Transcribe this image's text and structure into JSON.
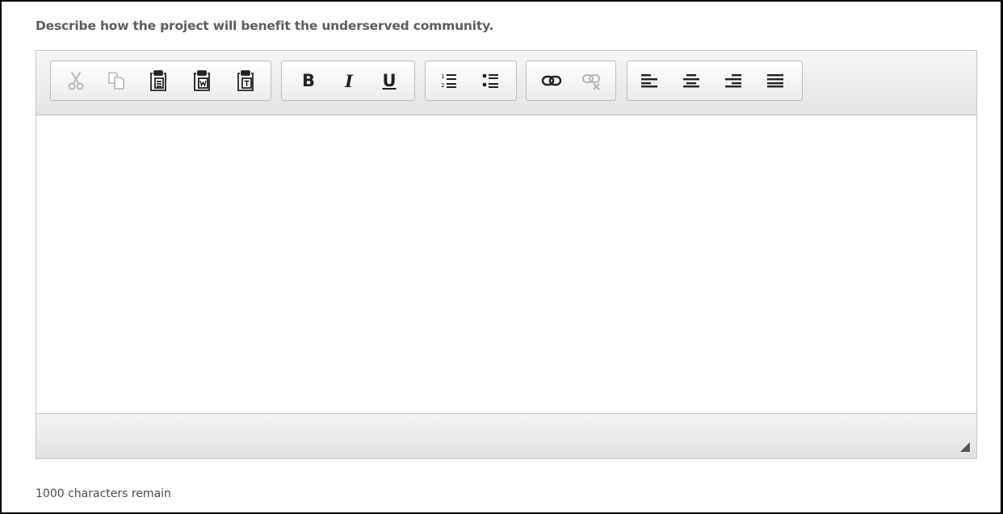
{
  "question": {
    "label": "Describe how the project will benefit the underserved community."
  },
  "editor": {
    "content": "",
    "toolbar": {
      "clipboard": [
        {
          "name": "cut-button",
          "icon": "scissors-icon",
          "enabled": false
        },
        {
          "name": "copy-button",
          "icon": "copy-icon",
          "enabled": false
        },
        {
          "name": "paste-button",
          "icon": "paste-icon",
          "enabled": true
        },
        {
          "name": "paste-from-word-button",
          "icon": "paste-word-icon",
          "enabled": true
        },
        {
          "name": "paste-as-text-button",
          "icon": "paste-text-icon",
          "enabled": true
        }
      ],
      "format": {
        "bold_label": "B",
        "italic_label": "I",
        "underline_label": "U"
      },
      "lists": [
        {
          "name": "numbered-list-button",
          "icon": "numbered-list-icon"
        },
        {
          "name": "bulleted-list-button",
          "icon": "bulleted-list-icon"
        }
      ],
      "links": [
        {
          "name": "link-button",
          "icon": "link-icon",
          "enabled": true
        },
        {
          "name": "unlink-button",
          "icon": "unlink-icon",
          "enabled": false
        }
      ],
      "align": [
        {
          "name": "align-left-button",
          "icon": "align-left-icon"
        },
        {
          "name": "align-center-button",
          "icon": "align-center-icon"
        },
        {
          "name": "align-right-button",
          "icon": "align-right-icon"
        },
        {
          "name": "align-justify-button",
          "icon": "align-justify-icon"
        }
      ]
    }
  },
  "counter": {
    "text": "1000 characters remain"
  },
  "colors": {
    "question_text": "#5e5e5e",
    "toolbar_bg": "#ececec",
    "border": "#c6c6c6",
    "disabled_icon": "#b5b5b5",
    "icon": "#222222"
  }
}
